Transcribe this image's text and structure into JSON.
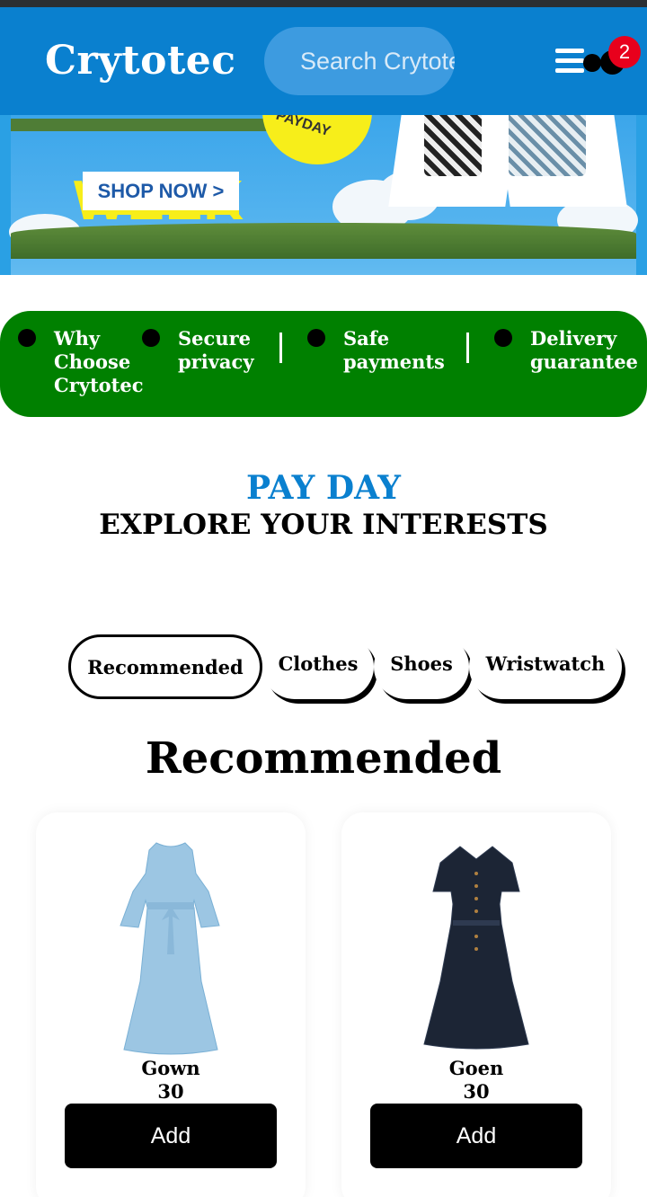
{
  "header": {
    "logo": "Crytotec",
    "search_placeholder": "Search Crytotec",
    "cart_count": "2",
    "menu_icon": "hamburger-menu-icon"
  },
  "banner": {
    "headline": "WEEK",
    "button_label": "SHOP NOW >",
    "badge_text": "PAYDAY"
  },
  "info_bar": {
    "items": [
      "Why Choose Crytotec",
      "Secure privacy",
      "Safe payments",
      "Delivery guarantee"
    ]
  },
  "promo": {
    "title": "PAY DAY",
    "subtitle": "EXPLORE YOUR INTERESTS"
  },
  "tabs": [
    {
      "label": "Recommended",
      "active": true
    },
    {
      "label": "Clothes",
      "active": false
    },
    {
      "label": "Shoes",
      "active": false
    },
    {
      "label": "Wristwatch",
      "active": false
    }
  ],
  "section_title": "Recommended",
  "products": [
    {
      "name": "Gown",
      "price": "30",
      "button": "Add",
      "color": "#9cc6e3"
    },
    {
      "name": "Goen",
      "price": "30",
      "button": "Add",
      "color": "#1c2535"
    }
  ],
  "colors": {
    "header": "#0a80cf",
    "info_bar": "#008000",
    "accent_title": "#0a80cf",
    "badge": "#e8001c"
  }
}
